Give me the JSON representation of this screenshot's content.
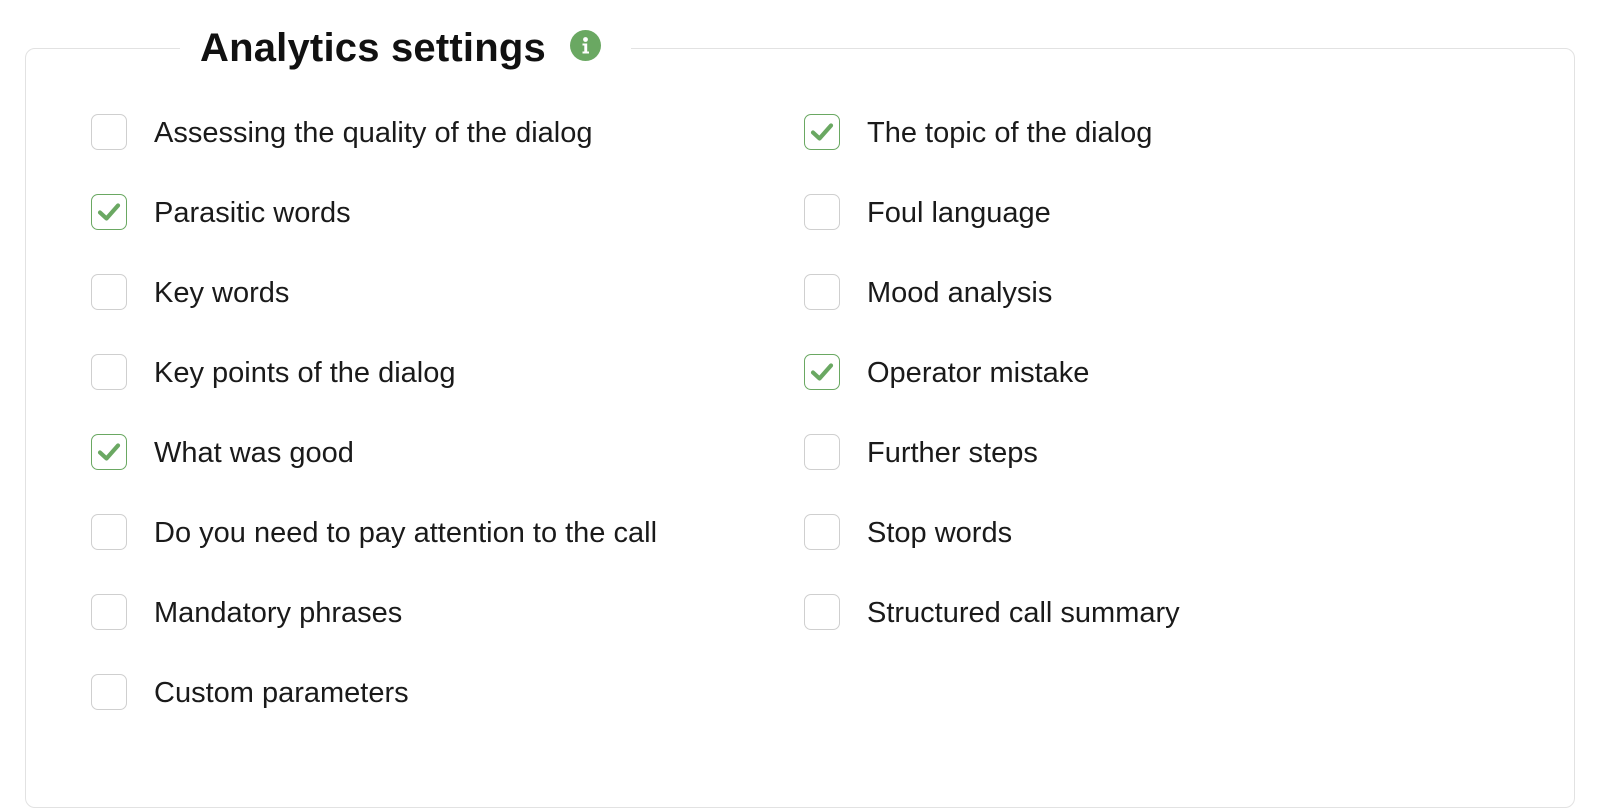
{
  "section": {
    "title": "Analytics settings",
    "info_icon": "info-icon",
    "accent_color": "#6aa862"
  },
  "left_options": [
    {
      "label": "Assessing the quality of the dialog",
      "checked": false
    },
    {
      "label": "Parasitic words",
      "checked": true
    },
    {
      "label": "Key words",
      "checked": false
    },
    {
      "label": "Key points of the dialog",
      "checked": false
    },
    {
      "label": "What was good",
      "checked": true
    },
    {
      "label": "Do you need to pay attention to the call",
      "checked": false
    },
    {
      "label": "Mandatory phrases",
      "checked": false
    },
    {
      "label": "Custom parameters",
      "checked": false
    }
  ],
  "right_options": [
    {
      "label": "The topic of the dialog",
      "checked": true
    },
    {
      "label": "Foul language",
      "checked": false
    },
    {
      "label": "Mood analysis",
      "checked": false
    },
    {
      "label": "Operator mistake",
      "checked": true
    },
    {
      "label": "Further steps",
      "checked": false
    },
    {
      "label": "Stop words",
      "checked": false
    },
    {
      "label": "Structured call summary",
      "checked": false
    }
  ]
}
